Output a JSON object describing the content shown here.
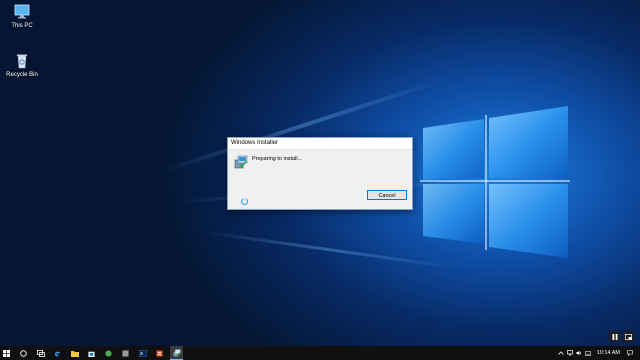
{
  "desktop": {
    "icons": [
      {
        "label": "This PC",
        "icon": "computer-icon"
      },
      {
        "label": "Recycle Bin",
        "icon": "recycle-bin-icon"
      }
    ]
  },
  "dialog": {
    "title": "Windows Installer",
    "message": "Preparing to install...",
    "cancel_label": "Cancel",
    "icon": "installer-icon"
  },
  "overlay": {
    "buttons": [
      "pause-icon",
      "picture-in-picture-icon"
    ]
  },
  "taskbar": {
    "items": [
      {
        "name": "start-button",
        "icon": "windows-logo-icon"
      },
      {
        "name": "search-button",
        "icon": "cortana-circle-icon"
      },
      {
        "name": "task-view-button",
        "icon": "task-view-icon"
      },
      {
        "name": "edge-button",
        "icon": "edge-icon"
      },
      {
        "name": "file-explorer-button",
        "icon": "folder-icon"
      },
      {
        "name": "store-button",
        "icon": "store-icon"
      },
      {
        "name": "app-green-button",
        "icon": "green-app-icon"
      },
      {
        "name": "app-gray-button",
        "icon": "gray-app-icon"
      },
      {
        "name": "powershell-button",
        "icon": "terminal-icon"
      },
      {
        "name": "app-orange-button",
        "icon": "orange-app-icon"
      },
      {
        "name": "installer-task-button",
        "icon": "installer-icon",
        "active": true
      }
    ],
    "tray": {
      "time": "10:14 AM",
      "icons": [
        "chevron-up-icon",
        "network-icon",
        "volume-icon",
        "keyboard-icon"
      ]
    }
  },
  "colors": {
    "accent": "#0078d7",
    "taskbar": "#101010"
  }
}
